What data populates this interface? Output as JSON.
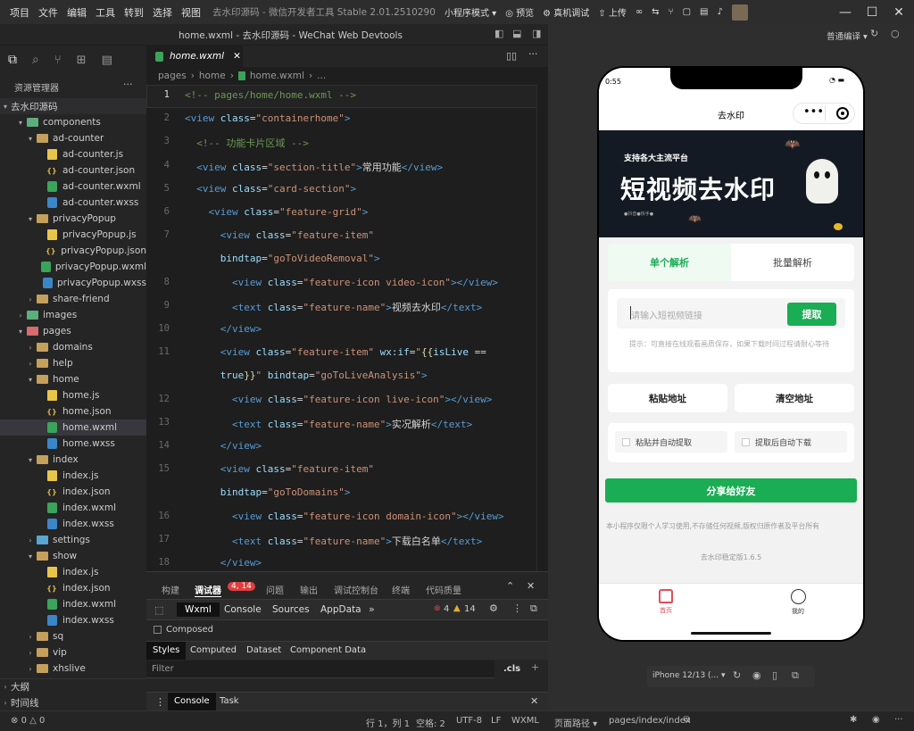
{
  "menu": [
    "项目",
    "文件",
    "编辑",
    "工具",
    "转到",
    "选择",
    "视图"
  ],
  "window_title": "去水印源码 - 微信开发者工具 Stable 2.01.2510290",
  "toolbar": {
    "mode": "小程序模式",
    "preview": "预览",
    "debug": "真机调试",
    "upload": "上传"
  },
  "editor_title": "home.wxml - 去水印源码 - WeChat Web Devtools",
  "sidebar": {
    "header": "资源管理器",
    "project": "去水印源码",
    "items": [
      {
        "label": "components",
        "indent": 1,
        "type": "folder-green",
        "open": true
      },
      {
        "label": "ad-counter",
        "indent": 2,
        "type": "folder",
        "open": true
      },
      {
        "label": "ad-counter.js",
        "indent": 3,
        "type": "js"
      },
      {
        "label": "ad-counter.json",
        "indent": 3,
        "type": "json"
      },
      {
        "label": "ad-counter.wxml",
        "indent": 3,
        "type": "wxml"
      },
      {
        "label": "ad-counter.wxss",
        "indent": 3,
        "type": "wxss"
      },
      {
        "label": "privacyPopup",
        "indent": 2,
        "type": "folder",
        "open": true
      },
      {
        "label": "privacyPopup.js",
        "indent": 3,
        "type": "js"
      },
      {
        "label": "privacyPopup.json",
        "indent": 3,
        "type": "json"
      },
      {
        "label": "privacyPopup.wxml",
        "indent": 3,
        "type": "wxml"
      },
      {
        "label": "privacyPopup.wxss",
        "indent": 3,
        "type": "wxss"
      },
      {
        "label": "share-friend",
        "indent": 2,
        "type": "folder",
        "open": false
      },
      {
        "label": "images",
        "indent": 1,
        "type": "folder-green",
        "open": false
      },
      {
        "label": "pages",
        "indent": 1,
        "type": "folder-pink",
        "open": true
      },
      {
        "label": "domains",
        "indent": 2,
        "type": "folder",
        "open": false
      },
      {
        "label": "help",
        "indent": 2,
        "type": "folder",
        "open": false
      },
      {
        "label": "home",
        "indent": 2,
        "type": "folder",
        "open": true
      },
      {
        "label": "home.js",
        "indent": 3,
        "type": "js"
      },
      {
        "label": "home.json",
        "indent": 3,
        "type": "json"
      },
      {
        "label": "home.wxml",
        "indent": 3,
        "type": "wxml",
        "selected": true
      },
      {
        "label": "home.wxss",
        "indent": 3,
        "type": "wxss"
      },
      {
        "label": "index",
        "indent": 2,
        "type": "folder",
        "open": true
      },
      {
        "label": "index.js",
        "indent": 3,
        "type": "js"
      },
      {
        "label": "index.json",
        "indent": 3,
        "type": "json"
      },
      {
        "label": "index.wxml",
        "indent": 3,
        "type": "wxml"
      },
      {
        "label": "index.wxss",
        "indent": 3,
        "type": "wxss"
      },
      {
        "label": "settings",
        "indent": 2,
        "type": "folder-blue",
        "open": false
      },
      {
        "label": "show",
        "indent": 2,
        "type": "folder",
        "open": true
      },
      {
        "label": "index.js",
        "indent": 3,
        "type": "js"
      },
      {
        "label": "index.json",
        "indent": 3,
        "type": "json"
      },
      {
        "label": "index.wxml",
        "indent": 3,
        "type": "wxml"
      },
      {
        "label": "index.wxss",
        "indent": 3,
        "type": "wxss"
      },
      {
        "label": "sq",
        "indent": 2,
        "type": "folder",
        "open": false
      },
      {
        "label": "vip",
        "indent": 2,
        "type": "folder",
        "open": false
      },
      {
        "label": "xhslive",
        "indent": 2,
        "type": "folder",
        "open": false
      }
    ],
    "outline": "大纲",
    "timeline": "时间线"
  },
  "editor": {
    "tab": "home.wxml",
    "breadcrumb": [
      "pages",
      "home",
      "home.wxml",
      "..."
    ],
    "lines": [
      {
        "n": "1",
        "h": "<span class=\"cm\">&lt;!-- pages/home/home.wxml --&gt;</span>"
      },
      {
        "n": "2",
        "h": "<span class=\"tg\">&lt;view</span> <span class=\"at\">class</span>=<span class=\"st\">\"containerhome\"</span><span class=\"tg\">&gt;</span>"
      },
      {
        "n": "3",
        "h": "  <span class=\"cm\">&lt;!-- 功能卡片区域 --&gt;</span>"
      },
      {
        "n": "4",
        "h": "  <span class=\"tg\">&lt;view</span> <span class=\"at\">class</span>=<span class=\"st\">\"section-title\"</span><span class=\"tg\">&gt;</span>常用功能<span class=\"tg\">&lt;/view&gt;</span>"
      },
      {
        "n": "5",
        "h": "  <span class=\"tg\">&lt;view</span> <span class=\"at\">class</span>=<span class=\"st\">\"card-section\"</span><span class=\"tg\">&gt;</span>"
      },
      {
        "n": "6",
        "h": "    <span class=\"tg\">&lt;view</span> <span class=\"at\">class</span>=<span class=\"st\">\"feature-grid\"</span><span class=\"tg\">&gt;</span>"
      },
      {
        "n": "7",
        "h": "      <span class=\"tg\">&lt;view</span> <span class=\"at\">class</span>=<span class=\"st\">\"feature-item\"</span>"
      },
      {
        "n": "",
        "h": "      <span class=\"at\">bindtap</span>=<span class=\"st\">\"goToVideoRemoval\"</span><span class=\"tg\">&gt;</span>"
      },
      {
        "n": "8",
        "h": "        <span class=\"tg\">&lt;view</span> <span class=\"at\">class</span>=<span class=\"st\">\"feature-icon video-icon\"</span><span class=\"tg\">&gt;&lt;/view&gt;</span>"
      },
      {
        "n": "9",
        "h": "        <span class=\"tg\">&lt;text</span> <span class=\"at\">class</span>=<span class=\"st\">\"feature-name\"</span><span class=\"tg\">&gt;</span>视频去水印<span class=\"tg\">&lt;/text&gt;</span>"
      },
      {
        "n": "10",
        "h": "      <span class=\"tg\">&lt;/view&gt;</span>"
      },
      {
        "n": "11",
        "h": "      <span class=\"tg\">&lt;view</span> <span class=\"at\">class</span>=<span class=\"st\">\"feature-item\"</span> <span class=\"at\">wx:if</span>=<span class=\"st\">\"</span><span class=\"br\">{{</span><span class=\"at\">isLive</span> <span class=\"tx\">==</span>"
      },
      {
        "n": "",
        "h": "      <span class=\"at\">true</span><span class=\"br\">}}</span><span class=\"st\">\"</span> <span class=\"at\">bindtap</span>=<span class=\"st\">\"goToLiveAnalysis\"</span><span class=\"tg\">&gt;</span>"
      },
      {
        "n": "12",
        "h": "        <span class=\"tg\">&lt;view</span> <span class=\"at\">class</span>=<span class=\"st\">\"feature-icon live-icon\"</span><span class=\"tg\">&gt;&lt;/view&gt;</span>"
      },
      {
        "n": "13",
        "h": "        <span class=\"tg\">&lt;text</span> <span class=\"at\">class</span>=<span class=\"st\">\"feature-name\"</span><span class=\"tg\">&gt;</span>实况解析<span class=\"tg\">&lt;/text&gt;</span>"
      },
      {
        "n": "14",
        "h": "      <span class=\"tg\">&lt;/view&gt;</span>"
      },
      {
        "n": "15",
        "h": "      <span class=\"tg\">&lt;view</span> <span class=\"at\">class</span>=<span class=\"st\">\"feature-item\"</span>"
      },
      {
        "n": "",
        "h": "      <span class=\"at\">bindtap</span>=<span class=\"st\">\"goToDomains\"</span><span class=\"tg\">&gt;</span>"
      },
      {
        "n": "16",
        "h": "        <span class=\"tg\">&lt;view</span> <span class=\"at\">class</span>=<span class=\"st\">\"feature-icon domain-icon\"</span><span class=\"tg\">&gt;&lt;/view&gt;</span>"
      },
      {
        "n": "17",
        "h": "        <span class=\"tg\">&lt;text</span> <span class=\"at\">class</span>=<span class=\"st\">\"feature-name\"</span><span class=\"tg\">&gt;</span>下载白名单<span class=\"tg\">&lt;/text&gt;</span>"
      },
      {
        "n": "18",
        "h": "      <span class=\"tg\">&lt;/view&gt;</span>"
      }
    ]
  },
  "panel": {
    "tabs": [
      "构建",
      "调试器",
      "问题",
      "输出",
      "调试控制台",
      "终端",
      "代码质量"
    ],
    "badge": "4, 14",
    "devtabs": [
      "Wxml",
      "Console",
      "Sources",
      "AppData"
    ],
    "errors": "4",
    "warnings": "14",
    "composed": "Composed",
    "styletabs": [
      "Styles",
      "Computed",
      "Dataset",
      "Component Data"
    ],
    "filter": "Filter",
    "cls": ".cls",
    "console_tabs": [
      "Console",
      "Task"
    ]
  },
  "status": {
    "errors": "0",
    "warnings": "0",
    "position": "行 1，列 1",
    "spaces": "空格: 2",
    "encoding": "UTF-8",
    "eol": "LF",
    "lang": "WXML",
    "page_path_label": "页面路径",
    "page_path": "pages/index/index"
  },
  "simulator": {
    "compile": "普通编译",
    "time": "0:55",
    "nav_title": "去水印",
    "banner_sub": "支持各大主流平台",
    "banner_title": "短视频去水印",
    "banner_small": "●抖音●快手●",
    "tab_single": "单个解析",
    "tab_batch": "批量解析",
    "input_placeholder": "请输入短视频链接",
    "extract": "提取",
    "tip": "提示：可直接在线观看画质保存，如果下载时间过程请耐心等待",
    "paste": "粘贴地址",
    "clear": "清空地址",
    "auto_extract": "粘贴并自动提取",
    "auto_download": "提取后自动下载",
    "share": "分享给好友",
    "disclaimer": "本小程序仅限个人学习使用,不存储任何视频,版权归原作者及平台所有",
    "version": "去水印稳定版1.6.5",
    "nav_home": "首页",
    "nav_mine": "我的",
    "device": "iPhone 12/13 (..."
  },
  "colors": {
    "accent": "#1aad54",
    "home_icon": "#e34d59"
  }
}
